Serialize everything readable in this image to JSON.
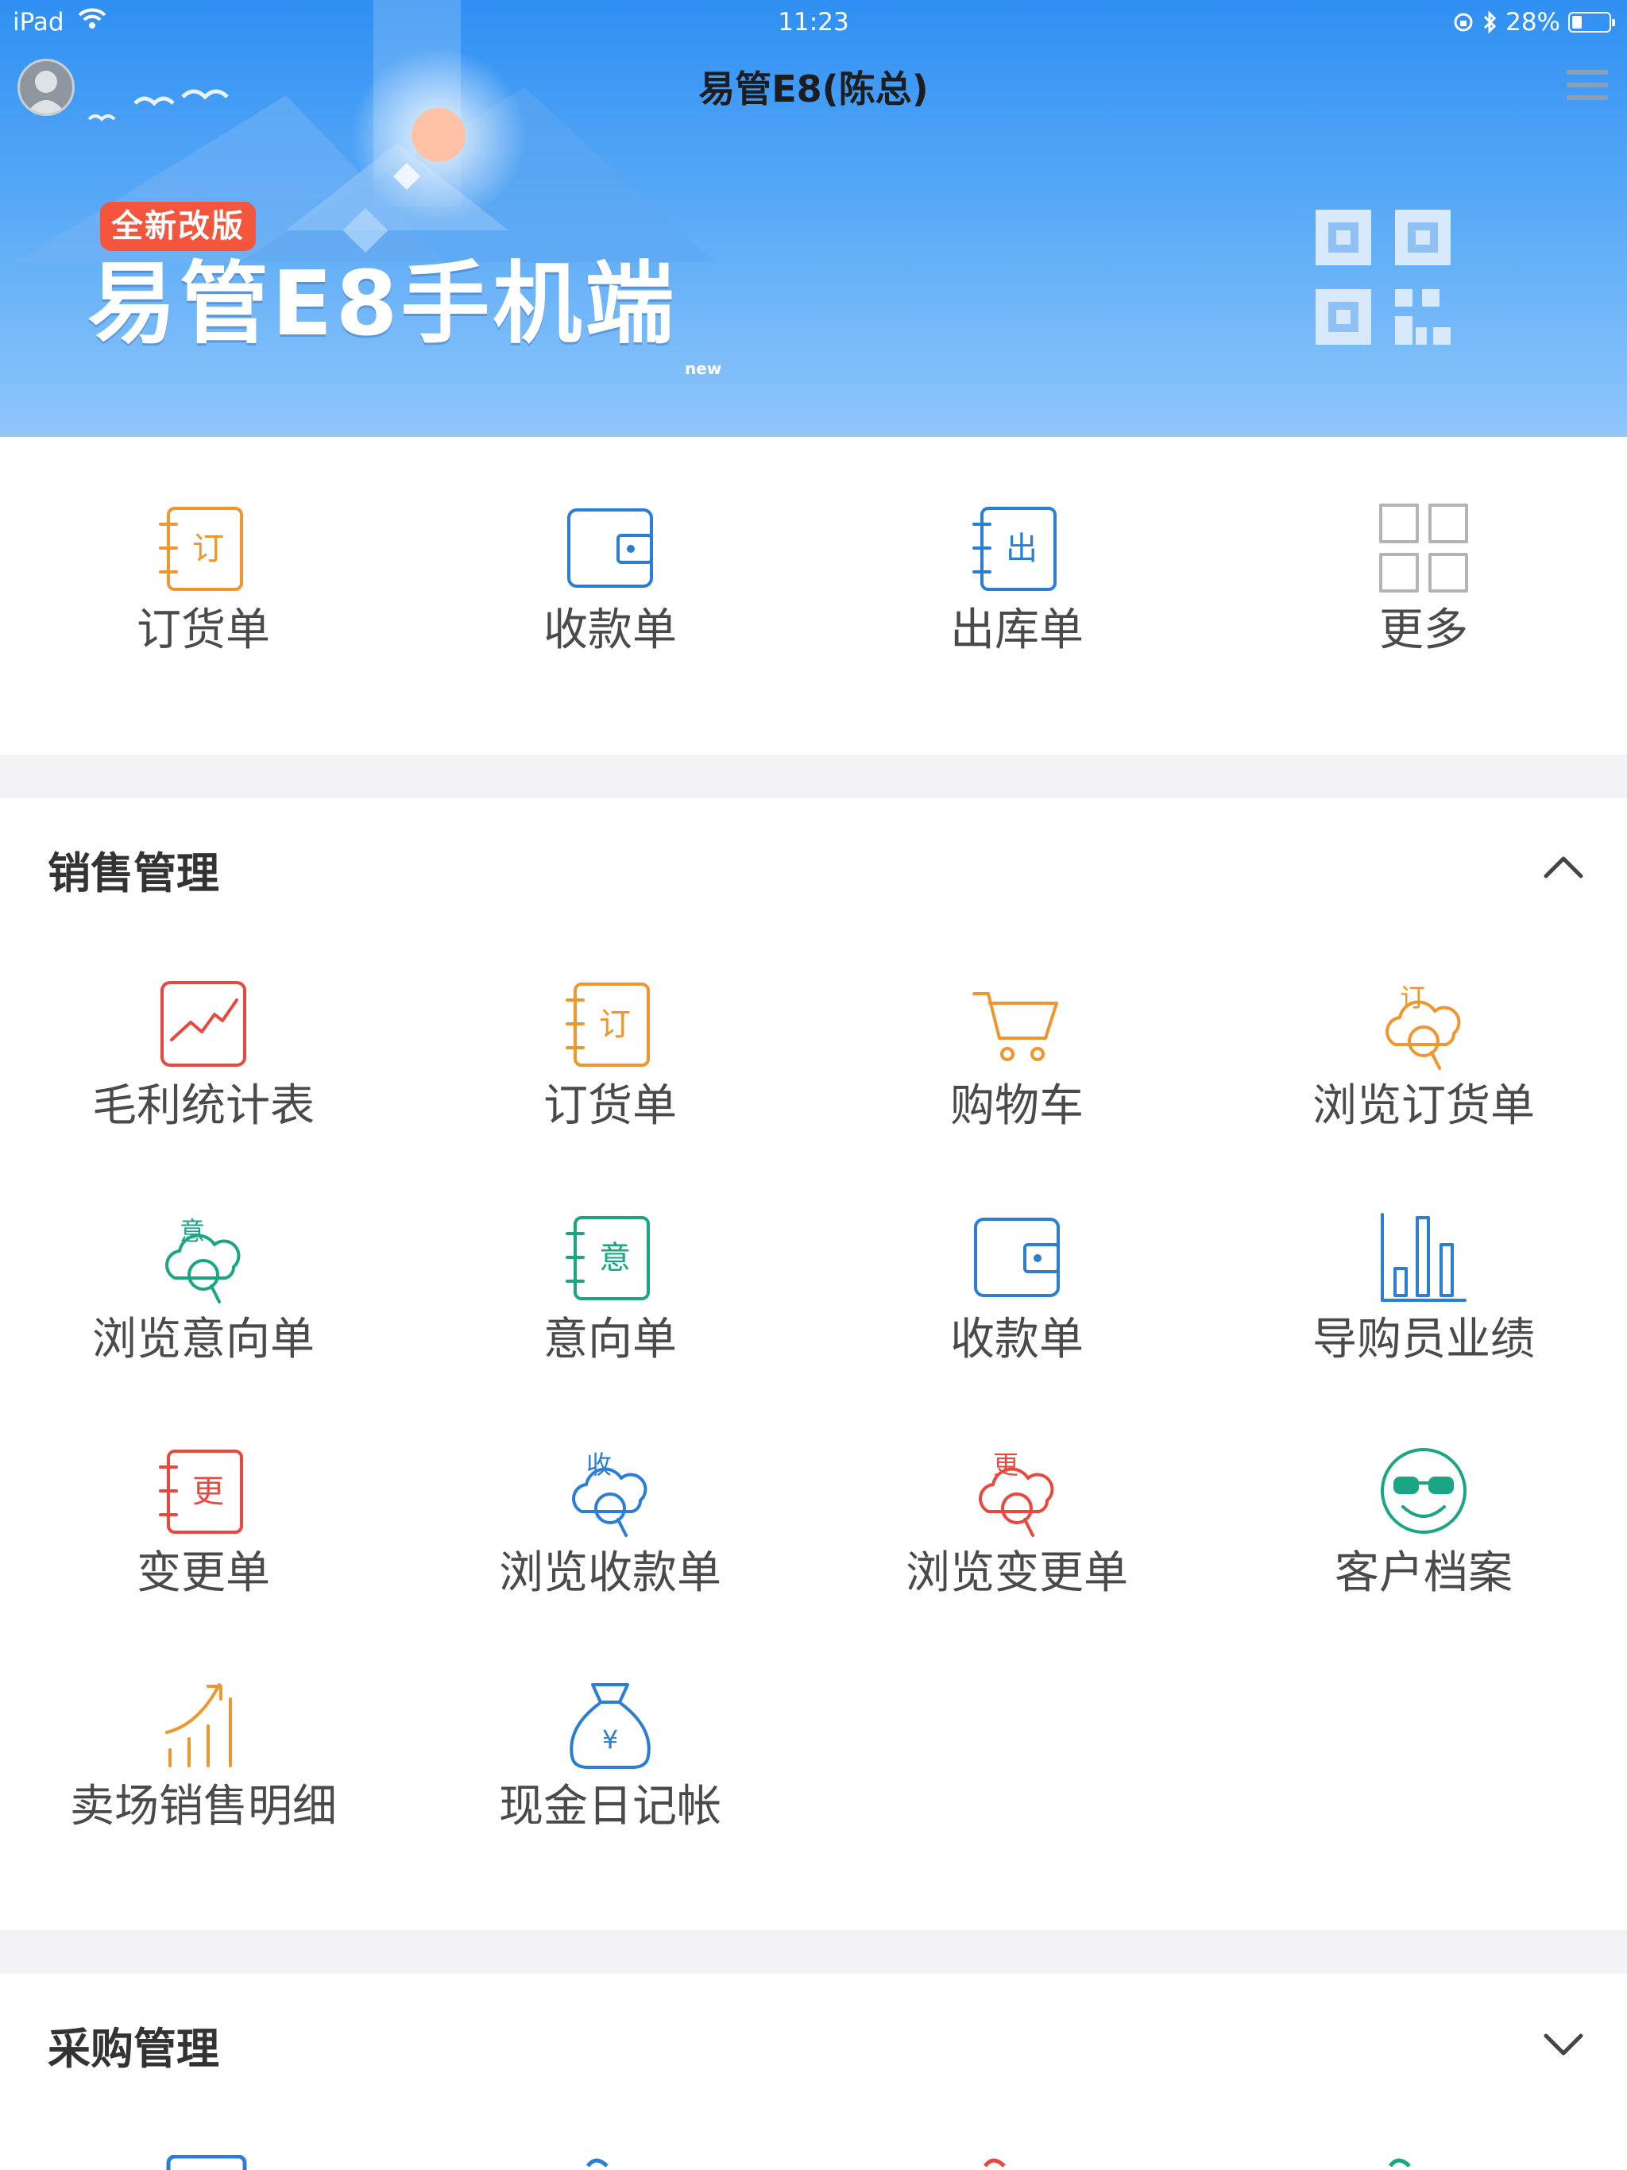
{
  "status_bar": {
    "carrier": "iPad",
    "time": "11:23",
    "battery": "28%",
    "battery_level": 0.28
  },
  "header": {
    "title": "易管E8(陈总)",
    "badge": "全新改版",
    "hero_title": "易管E8手机端",
    "hero_sub": "new"
  },
  "quick_actions": [
    {
      "label": "订货单",
      "icon": "order-book-icon",
      "glyph": "订",
      "color": "#f0962e"
    },
    {
      "label": "收款单",
      "icon": "wallet-icon",
      "color": "#2a7fd4"
    },
    {
      "label": "出库单",
      "icon": "outbound-book-icon",
      "glyph": "出",
      "color": "#2a7fd4"
    },
    {
      "label": "更多",
      "icon": "grid-more-icon",
      "color": "#b4b4b4"
    }
  ],
  "sections": {
    "sales": {
      "title": "销售管理",
      "expanded": true,
      "items": [
        {
          "label": "毛利统计表",
          "icon": "profit-chart-icon",
          "color": "#e8483d"
        },
        {
          "label": "订货单",
          "icon": "order-book-icon",
          "glyph": "订",
          "color": "#f0962e"
        },
        {
          "label": "购物车",
          "icon": "cart-icon",
          "color": "#f0962e"
        },
        {
          "label": "浏览订货单",
          "icon": "browse-order-icon",
          "glyph": "订",
          "color": "#f0962e"
        },
        {
          "label": "浏览意向单",
          "icon": "browse-intent-icon",
          "glyph": "意",
          "color": "#1aa584"
        },
        {
          "label": "意向单",
          "icon": "intent-book-icon",
          "glyph": "意",
          "color": "#1aa584"
        },
        {
          "label": "收款单",
          "icon": "wallet-icon",
          "color": "#2a7fd4"
        },
        {
          "label": "导购员业绩",
          "icon": "bar-chart-icon",
          "color": "#2a7fd4"
        },
        {
          "label": "变更单",
          "icon": "change-book-icon",
          "glyph": "更",
          "color": "#e8483d"
        },
        {
          "label": "浏览收款单",
          "icon": "browse-receipt-icon",
          "glyph": "收",
          "color": "#2a7fd4"
        },
        {
          "label": "浏览变更单",
          "icon": "browse-change-icon",
          "glyph": "更",
          "color": "#e8483d"
        },
        {
          "label": "客户档案",
          "icon": "customer-face-icon",
          "color": "#1aa584"
        },
        {
          "label": "卖场销售明细",
          "icon": "sales-growth-icon",
          "color": "#f0962e"
        },
        {
          "label": "现金日记帐",
          "icon": "money-bag-icon",
          "color": "#2a7fd4"
        }
      ]
    },
    "purchase": {
      "title": "采购管理",
      "expanded": false
    }
  }
}
